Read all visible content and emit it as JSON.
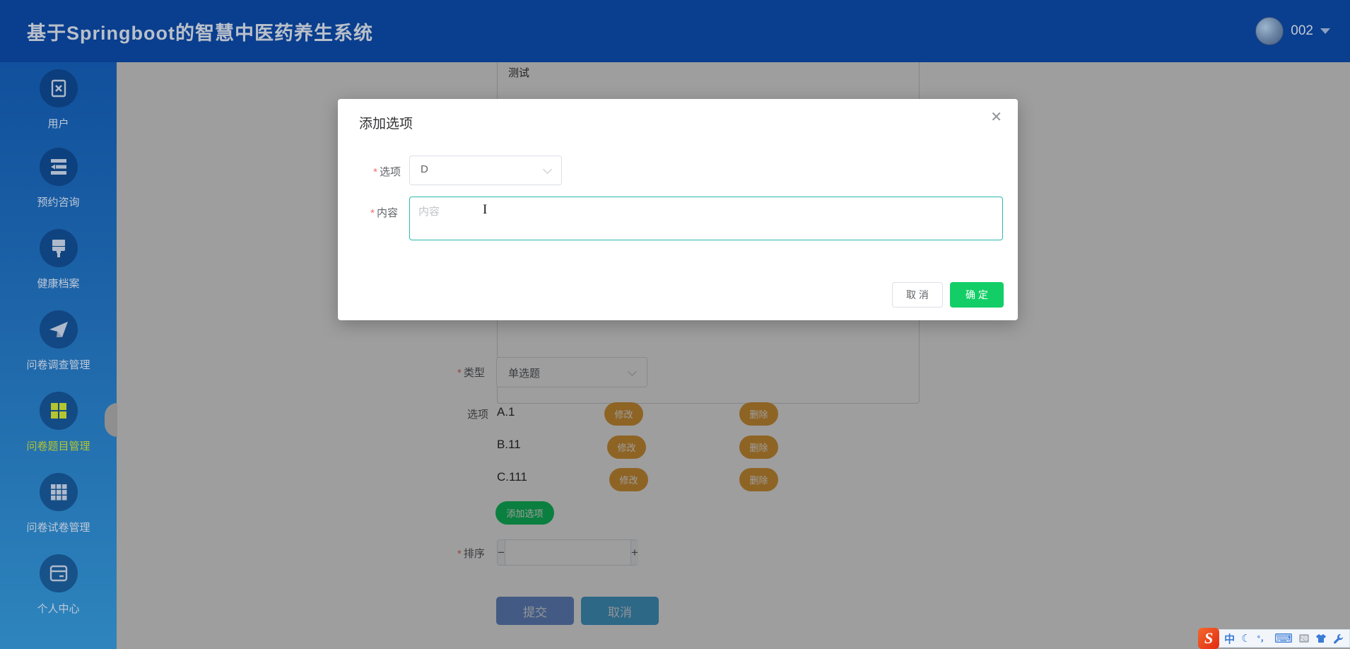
{
  "header": {
    "title": "基于Springboot的智慧中医药养生系统",
    "user": {
      "name": "002"
    }
  },
  "sidebar": {
    "items": [
      {
        "label": "用户",
        "icon": "user-card-icon",
        "active": false
      },
      {
        "label": "预约咨询",
        "icon": "consult-list-icon",
        "active": false
      },
      {
        "label": "健康档案",
        "icon": "health-brush-icon",
        "active": false
      },
      {
        "label": "问卷调查管理",
        "icon": "survey-plane-icon",
        "active": false
      },
      {
        "label": "问卷题目管理",
        "icon": "question-grid-icon",
        "active": true
      },
      {
        "label": "问卷试卷管理",
        "icon": "paper-grid-icon",
        "active": false
      },
      {
        "label": "个人中心",
        "icon": "profile-card-icon",
        "active": false
      }
    ]
  },
  "content": {
    "question_text": "测试",
    "type_row": {
      "required": "*",
      "label": "类型",
      "value": "单选题"
    },
    "options_row": {
      "label": "选项",
      "options": [
        {
          "text": "A.1",
          "edit": "修改",
          "delete": "删除"
        },
        {
          "text": "B.11",
          "edit": "修改",
          "delete": "删除"
        },
        {
          "text": "C.111",
          "edit": "修改",
          "delete": "删除"
        }
      ],
      "add_button": "添加选项"
    },
    "sort_row": {
      "required": "*",
      "label": "排序",
      "minus": "−",
      "plus": "+",
      "value": ""
    },
    "submit_button": "提交",
    "cancel_button": "取消"
  },
  "modal": {
    "title": "添加选项",
    "close": "✕",
    "option_row": {
      "required": "*",
      "label": "选项",
      "value": "D"
    },
    "content_row": {
      "required": "*",
      "label": "内容",
      "placeholder": "内容",
      "cursor": "I"
    },
    "cancel_button": "取 消",
    "confirm_button": "确 定"
  },
  "ime_bar": {
    "logo": "S",
    "mode": "中",
    "moon": "☾",
    "punct": "°，",
    "keyboard": "⌨",
    "badge": "20"
  },
  "colors": {
    "header_bg": "#0a3e8e",
    "sidebar_top": "#11509c",
    "sidebar_bottom": "#2e85bd",
    "accent_green": "#13ce66",
    "warning_orange": "#e6a23c",
    "focus_teal": "#2cb9ac",
    "active_menu": "#b5c52f",
    "required_red": "#f56c6c"
  }
}
